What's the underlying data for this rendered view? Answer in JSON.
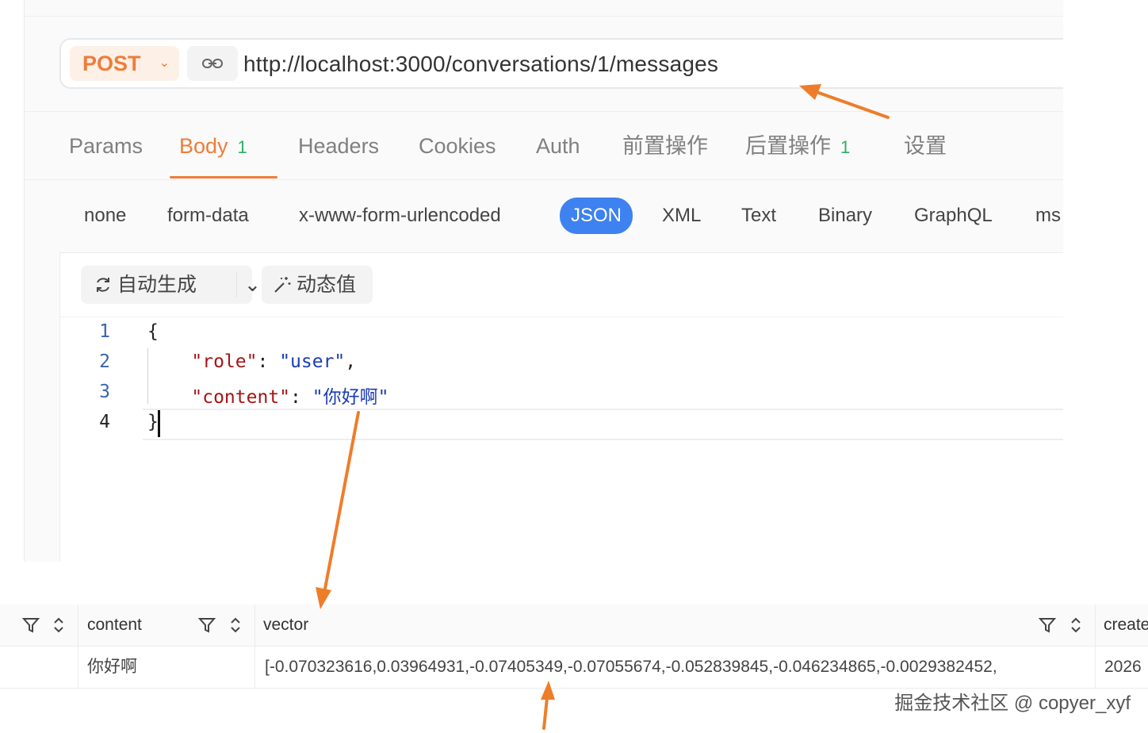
{
  "request": {
    "method": "POST",
    "url": "http://localhost:3000/conversations/1/messages"
  },
  "tabs": [
    {
      "label": "Params"
    },
    {
      "label": "Body",
      "badge": "1"
    },
    {
      "label": "Headers"
    },
    {
      "label": "Cookies"
    },
    {
      "label": "Auth"
    },
    {
      "label": "前置操作"
    },
    {
      "label": "后置操作",
      "badge": "1"
    },
    {
      "label": "设置"
    }
  ],
  "body_types": [
    "none",
    "form-data",
    "x-www-form-urlencoded",
    "JSON",
    "XML",
    "Text",
    "Binary",
    "GraphQL",
    "ms"
  ],
  "selected_body_type": "JSON",
  "editor_toolbar": {
    "auto_generate": "自动生成",
    "dynamic_value": "动态值"
  },
  "code_lines": [
    {
      "num": "1",
      "text": "{"
    },
    {
      "num": "2",
      "key": "\"role\"",
      "colon": ": ",
      "value": "\"user\"",
      "trail": ","
    },
    {
      "num": "3",
      "key": "\"content\"",
      "colon": ": ",
      "value": "\"你好啊\"",
      "trail": ""
    },
    {
      "num": "4",
      "text": "}"
    }
  ],
  "table": {
    "columns": [
      "content",
      "vector",
      "create"
    ],
    "rows": [
      {
        "content": "你好啊",
        "vector": "[-0.070323616,0.03964931,-0.07405349,-0.07055674,-0.052839845,-0.046234865,-0.0029382452,",
        "created": "2026"
      }
    ]
  },
  "watermark": "掘金技术社区 @ copyer_xyf",
  "colors": {
    "accent_orange": "#ee7d3a",
    "json_blue": "#3d82f0",
    "badge_green": "#2fae62",
    "arrow_orange": "#ee7d2a"
  }
}
